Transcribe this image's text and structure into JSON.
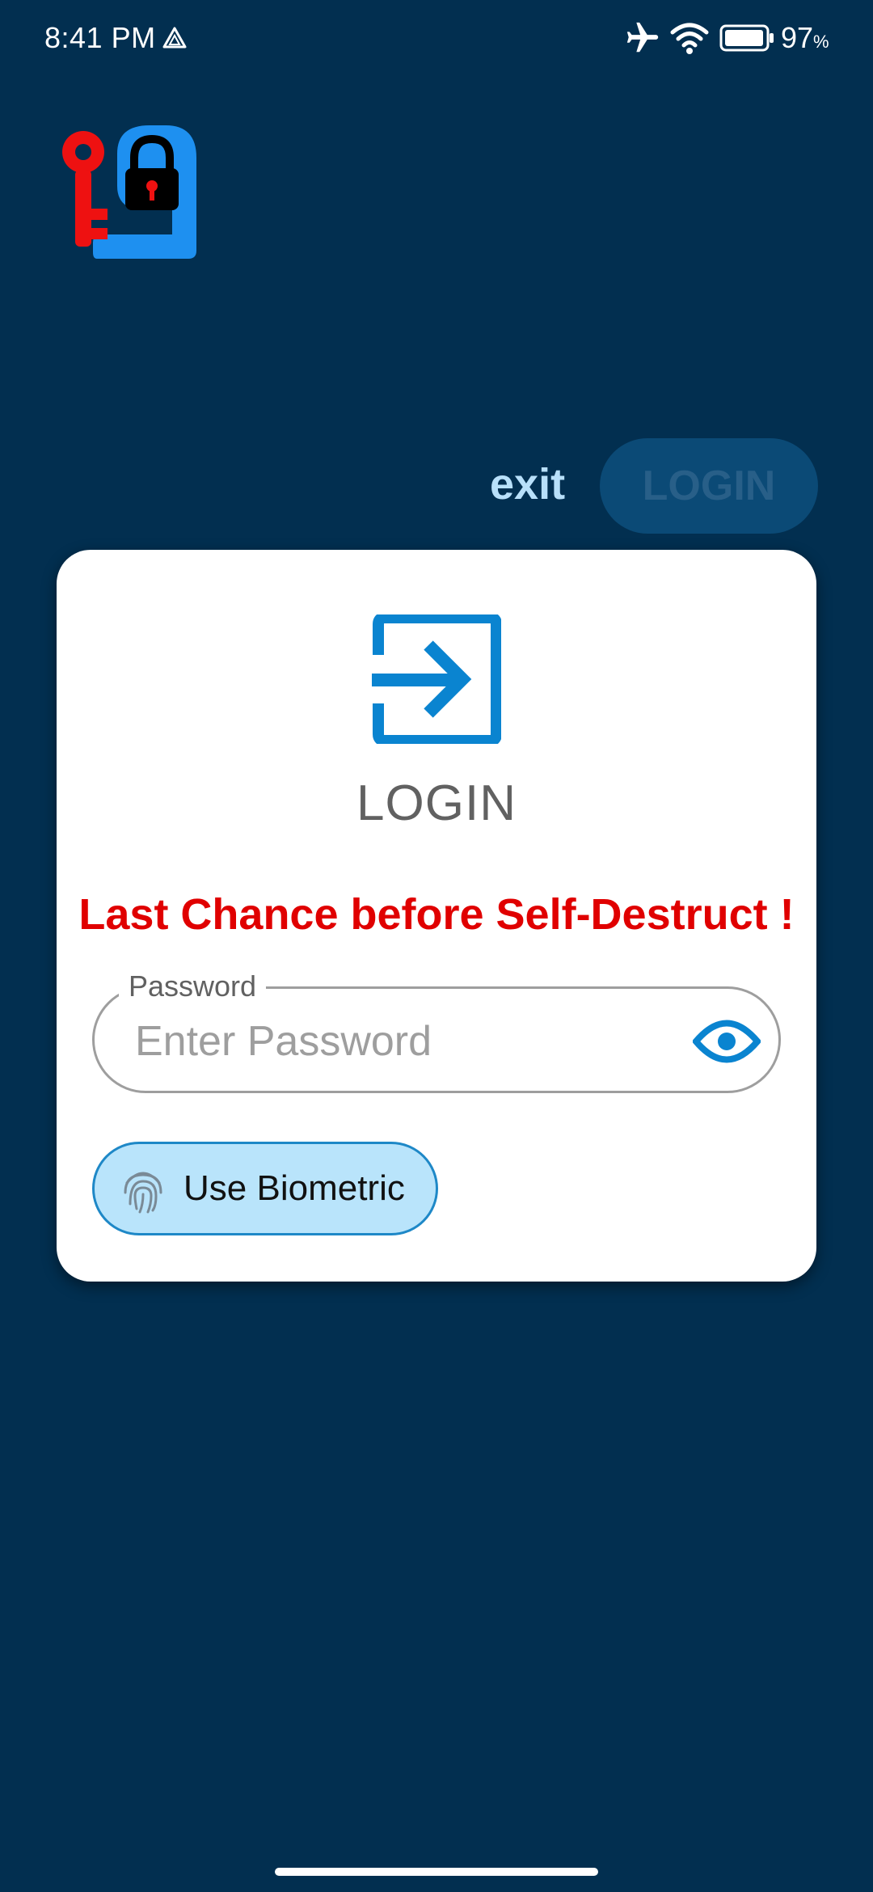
{
  "status_bar": {
    "time": "8:41 PM",
    "battery_level": "97",
    "battery_unit": "%",
    "icons": [
      "drive-icon",
      "airplane-mode-icon",
      "wifi-icon",
      "battery-icon"
    ]
  },
  "app": {
    "logo_icon": "key-lock-logo-icon"
  },
  "top_actions": {
    "exit_label": "exit",
    "login_label": "LOGIN"
  },
  "card": {
    "icon": "login-arrow-icon",
    "title": "LOGIN",
    "warning": "Last Chance before Self-Destruct !",
    "password": {
      "label": "Password",
      "placeholder": "Enter Password",
      "value": "",
      "toggle_icon": "eye-icon"
    },
    "biometric": {
      "label": "Use Biometric",
      "icon": "fingerprint-icon"
    }
  },
  "colors": {
    "background": "#022f50",
    "accent": "#0a84d0",
    "warning": "#e00000",
    "exit": "#b8e0fa",
    "biometric_bg": "#b9e4fb"
  }
}
